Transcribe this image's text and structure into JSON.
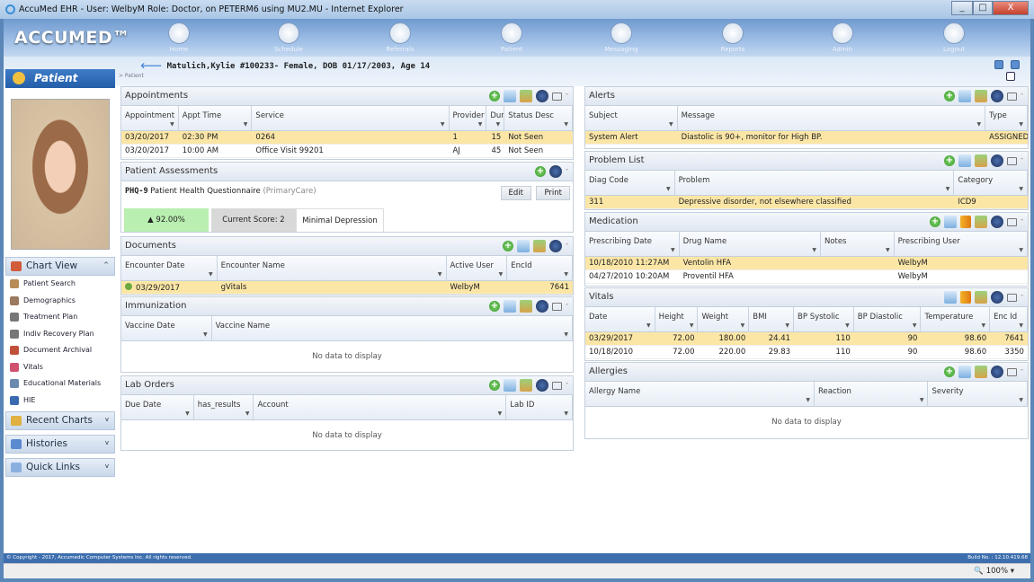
{
  "window": {
    "title": "AccuMed EHR - User: WelbyM Role: Doctor, on PETERM6 using MU2.MU - Internet Explorer"
  },
  "nav": {
    "logo": "ACCUMED™",
    "items": [
      {
        "label": "Home",
        "icon": "home-icon"
      },
      {
        "label": "Schedule",
        "icon": "schedule-icon"
      },
      {
        "label": "Referrals",
        "icon": "referrals-icon"
      },
      {
        "label": "Patient",
        "icon": "patient-icon"
      },
      {
        "label": "Messaging",
        "icon": "messaging-icon"
      },
      {
        "label": "Reports",
        "icon": "reports-icon"
      },
      {
        "label": "Admin",
        "icon": "admin-icon"
      },
      {
        "label": "Logout",
        "icon": "logout-icon"
      }
    ]
  },
  "patient_header": {
    "title": "Matulich,Kylie #100233- Female, DOB 01/17/2003, Age 14",
    "breadcrumb": "> Patient"
  },
  "sidebar": {
    "patient_tab": "Patient",
    "chart_view": "Chart View",
    "items": [
      "Patient Search",
      "Demographics",
      "Treatment Plan",
      "Indiv Recovery Plan",
      "Document Archival",
      "Vitals",
      "Educational Materials",
      "HIE"
    ],
    "sections": [
      "Recent Charts",
      "Histories",
      "Quick Links"
    ]
  },
  "assessment": {
    "title": "Patient Assessments",
    "code": "PHQ-9",
    "name": "Patient Health Questionnaire",
    "category": "(PrimaryCare)",
    "edit": "Edit",
    "print": "Print",
    "percent": "▲ 92.00%",
    "score": "Current Score: 2",
    "result": "Minimal Depression"
  },
  "panels": [
    {
      "id": "appointments",
      "title": "Appointments",
      "tools": [
        "add",
        "export",
        "edit",
        "filter",
        "print",
        "min"
      ],
      "columns": [
        "Appointment",
        "Appt Time",
        "Service",
        "Provider",
        "Duration",
        "Status Desc"
      ],
      "rows": [
        [
          "03/20/2017",
          "02:30 PM",
          "0264",
          "1",
          "15",
          "Not Seen"
        ],
        [
          "03/20/2017",
          "10:00 AM",
          "Office Visit 99201",
          "AJ",
          "45",
          "Not Seen"
        ]
      ],
      "selected_row": 0
    },
    {
      "id": "documents",
      "title": "Documents",
      "tools": [
        "add",
        "export",
        "edit",
        "filter",
        "min"
      ],
      "columns": [
        "Encounter Date",
        "Encounter Name",
        "Active User",
        "EncId"
      ],
      "rows": [
        [
          "03/29/2017",
          "gVitals",
          "WelbyM",
          "7641"
        ]
      ],
      "selected_row": 0
    },
    {
      "id": "immunization",
      "title": "Immunization",
      "tools": [
        "add",
        "export",
        "edit",
        "filter",
        "print",
        "min"
      ],
      "columns": [
        "Vaccine Date",
        "Vaccine Name"
      ],
      "rows": [],
      "empty": "No data to display"
    },
    {
      "id": "lab-orders",
      "title": "Lab Orders",
      "tools": [
        "add",
        "export",
        "edit",
        "filter",
        "print",
        "min"
      ],
      "columns": [
        "Due Date",
        "has_results",
        "Account",
        "Lab ID"
      ],
      "rows": [],
      "empty": "No data to display"
    },
    {
      "id": "alerts",
      "title": "Alerts",
      "tools": [
        "add",
        "export",
        "edit",
        "filter",
        "print",
        "min"
      ],
      "columns": [
        "Subject",
        "Message",
        "Type"
      ],
      "rows": [
        [
          "System Alert",
          "Diastolic is 90+, monitor for High BP.",
          "ASSIGNED"
        ]
      ],
      "selected_row": 0
    },
    {
      "id": "problem-list",
      "title": "Problem List",
      "tools": [
        "add",
        "export",
        "edit",
        "filter",
        "print",
        "min"
      ],
      "columns": [
        "Diag Code",
        "Problem",
        "Category"
      ],
      "rows": [
        [
          "311",
          "Depressive disorder, not elsewhere classified",
          "ICD9"
        ]
      ],
      "selected_row": 0
    },
    {
      "id": "medication",
      "title": "Medication",
      "tools": [
        "add",
        "export",
        "chart",
        "edit",
        "filter",
        "print",
        "min"
      ],
      "columns": [
        "Prescribing Date",
        "Drug Name",
        "Notes",
        "Prescribing User"
      ],
      "rows": [
        [
          "10/18/2010 11:27AM",
          "Ventolin HFA",
          "",
          "WelbyM"
        ],
        [
          "04/27/2010 10:20AM",
          "Proventil HFA",
          "",
          "WelbyM"
        ]
      ],
      "selected_row": 0
    },
    {
      "id": "vitals",
      "title": "Vitals",
      "tools": [
        "export",
        "chart",
        "edit",
        "filter",
        "print",
        "min"
      ],
      "columns": [
        "Date",
        "Height",
        "Weight",
        "BMI",
        "BP Systolic",
        "BP Diastolic",
        "Temperature",
        "Enc Id"
      ],
      "rows": [
        [
          "03/29/2017",
          "72.00",
          "180.00",
          "24.41",
          "110",
          "90",
          "98.60",
          "7641"
        ],
        [
          "10/18/2010",
          "72.00",
          "220.00",
          "29.83",
          "110",
          "90",
          "98.60",
          "3350"
        ]
      ],
      "selected_row": 0
    },
    {
      "id": "allergies",
      "title": "Allergies",
      "tools": [
        "add",
        "export",
        "edit",
        "filter",
        "print",
        "min"
      ],
      "columns": [
        "Allergy Name",
        "Reaction",
        "Severity"
      ],
      "rows": [],
      "empty": "No data to display"
    }
  ],
  "footer": {
    "copyright": "© Copyright - 2017, Accumedic Computer Systems Inc. All rights reserved.",
    "build": "Build No. : 12.10.419.68"
  },
  "status": {
    "zoom": "100%"
  },
  "colors": {
    "selected_row": "#fbe6a6",
    "nav_blue": "#6f9ad0",
    "footer_blue": "#3d6fae",
    "score_green": "#b9efb0"
  }
}
